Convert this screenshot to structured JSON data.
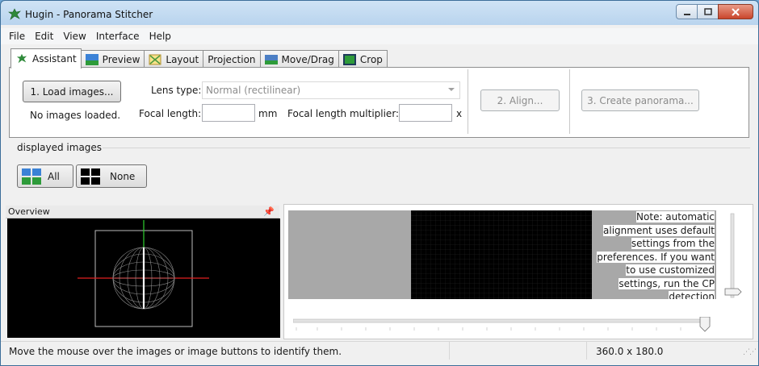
{
  "window": {
    "title": "Hugin - Panorama Stitcher",
    "icon": "hugin-leaf-icon",
    "controls": [
      "minimize",
      "maximize",
      "close"
    ]
  },
  "menu": [
    "File",
    "Edit",
    "View",
    "Interface",
    "Help"
  ],
  "tabs": [
    {
      "label": "Assistant",
      "icon": "hugin-leaf-icon",
      "active": true
    },
    {
      "label": "Preview",
      "icon": "landscape-icon"
    },
    {
      "label": "Layout",
      "icon": "layout-grid-icon"
    },
    {
      "label": "Projection",
      "icon": ""
    },
    {
      "label": "Move/Drag",
      "icon": "move-drag-icon"
    },
    {
      "label": "Crop",
      "icon": "crop-icon"
    }
  ],
  "assistant": {
    "load_button": "1. Load images...",
    "load_status": "No images loaded.",
    "lens_type_label": "Lens type:",
    "lens_type_value": "Normal (rectilinear)",
    "focal_length_label": "Focal length:",
    "focal_length_unit": "mm",
    "focal_length_value": "",
    "focal_multiplier_label": "Focal length multiplier:",
    "focal_multiplier_unit": "x",
    "focal_multiplier_value": "",
    "align_button": "2. Align...",
    "create_button": "3. Create panorama..."
  },
  "displayed_images": {
    "group_label": "displayed images",
    "all_button": "All",
    "none_button": "None"
  },
  "overview": {
    "title": "Overview",
    "pin_icon": "pin-icon"
  },
  "preview": {
    "note": "Note: automatic alignment uses default settings from the preferences. If you want to use customized settings, run the CP detection"
  },
  "status": {
    "message": "Move the mouse over the images or image buttons to identify them.",
    "fov": "360.0 x 180.0"
  },
  "colors": {
    "accent_green": "#2f8a3a",
    "overview_bg": "#000000",
    "horizon_red": "#e02020",
    "axis_green": "#30d030"
  }
}
